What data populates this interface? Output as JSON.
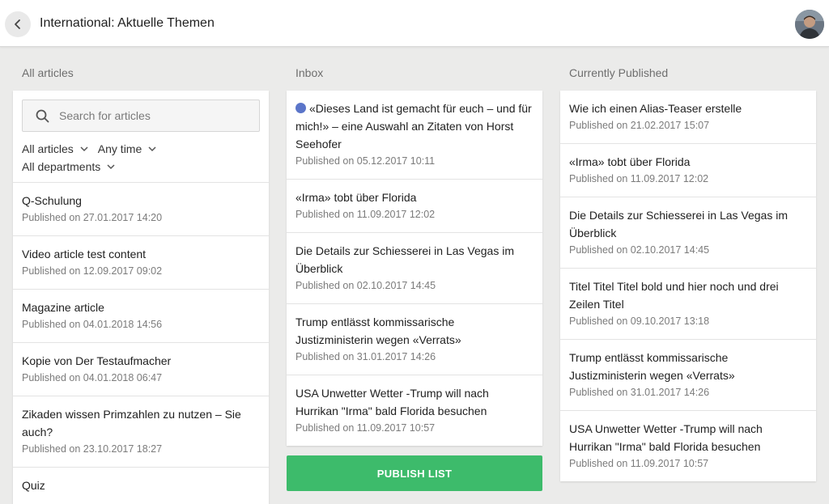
{
  "header": {
    "title": "International: Aktuelle Themen",
    "back_icon": "chevron-left-icon",
    "avatar_icon": "user-avatar"
  },
  "all_articles": {
    "title": "All articles",
    "search": {
      "placeholder": "Search for articles",
      "value": ""
    },
    "filters": {
      "articles": "All articles",
      "time": "Any time",
      "departments": "All departments"
    },
    "items": [
      {
        "title": "Q-Schulung",
        "meta": "Published on 27.01.2017 14:20"
      },
      {
        "title": "Video article test content",
        "meta": "Published on 12.09.2017 09:02"
      },
      {
        "title": "Magazine article",
        "meta": "Published on 04.01.2018 14:56"
      },
      {
        "title": "Kopie von Der Testaufmacher",
        "meta": "Published on 04.01.2018 06:47"
      },
      {
        "title": "Zikaden wissen Primzahlen zu nutzen – Sie auch?",
        "meta": "Published on 23.10.2017 18:27"
      },
      {
        "title": "Quiz",
        "meta": ""
      }
    ]
  },
  "inbox": {
    "title": "Inbox",
    "items": [
      {
        "title": "«Dieses Land ist gemacht für euch – und für mich!» – eine Auswahl an Zitaten von Horst Seehofer",
        "meta": "Published on 05.12.2017 10:11",
        "unread": true
      },
      {
        "title": "«Irma» tobt über Florida",
        "meta": "Published on 11.09.2017 12:02"
      },
      {
        "title": "Die Details zur Schiesserei in Las Vegas im Überblick",
        "meta": "Published on 02.10.2017 14:45"
      },
      {
        "title": "Trump entlässt kommissarische Justizministerin wegen «Verrats»",
        "meta": "Published on 31.01.2017 14:26"
      },
      {
        "title": "USA Unwetter Wetter -Trump will nach Hurrikan \"Irma\" bald Florida besuchen",
        "meta": "Published on 11.09.2017 10:57"
      }
    ],
    "publish_label": "PUBLISH LIST",
    "unread_color": "#5b75c9",
    "publish_color": "#3dbb6b"
  },
  "published": {
    "title": "Currently Published",
    "items": [
      {
        "title": "Wie ich einen Alias-Teaser erstelle",
        "meta": "Published on 21.02.2017 15:07"
      },
      {
        "title": "«Irma» tobt über Florida",
        "meta": "Published on 11.09.2017 12:02"
      },
      {
        "title": "Die Details zur Schiesserei in Las Vegas im Überblick",
        "meta": "Published on 02.10.2017 14:45"
      },
      {
        "title": "Titel Titel Titel bold und hier noch und drei Zeilen Titel",
        "meta": "Published on 09.10.2017 13:18"
      },
      {
        "title": "Trump entlässt kommissarische Justizministerin wegen «Verrats»",
        "meta": "Published on 31.01.2017 14:26"
      },
      {
        "title": "USA Unwetter Wetter -Trump will nach Hurrikan \"Irma\" bald Florida besuchen",
        "meta": "Published on 11.09.2017 10:57"
      }
    ]
  }
}
